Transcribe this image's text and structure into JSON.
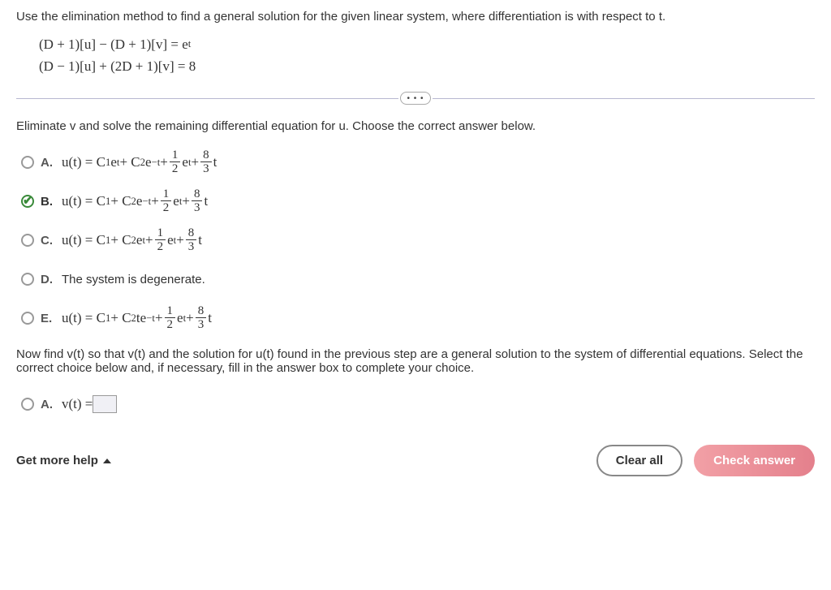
{
  "question": "Use the elimination method to find a general solution for the given linear system, where differentiation is with respect to t.",
  "eq1": "(D + 1)[u] − (D + 1)[v]  =  e",
  "eq1_sup": "t",
  "eq2": "(D − 1)[u] + (2D + 1)[v]  =  8",
  "dots": "• • •",
  "subq1": "Eliminate v and solve the remaining differential equation for u. Choose the correct answer below.",
  "options": {
    "A": {
      "letter": "A.",
      "pre": "u(t) = C",
      "sub1": "1",
      "mid1": " e",
      "sup1": "t",
      "mid2": " + C",
      "sub2": "2",
      "mid3": " e",
      "sup2": "−t",
      "plus1": " + ",
      "f1n": "1",
      "f1d": "2",
      "mid4": " e",
      "sup3": "t",
      "plus2": " + ",
      "f2n": "8",
      "f2d": "3",
      "tail": "t"
    },
    "B": {
      "letter": "B.",
      "pre": "u(t) = C",
      "sub1": "1",
      "mid1": "",
      "sup1": "",
      "mid2": " + C",
      "sub2": "2",
      "mid3": " e",
      "sup2": "−t",
      "plus1": " + ",
      "f1n": "1",
      "f1d": "2",
      "mid4": " e",
      "sup3": "t",
      "plus2": " + ",
      "f2n": "8",
      "f2d": "3",
      "tail": "t"
    },
    "C": {
      "letter": "C.",
      "pre": "u(t) = C",
      "sub1": "1",
      "mid1": "",
      "sup1": "",
      "mid2": " + C",
      "sub2": "2",
      "mid3": " e",
      "sup2": "t",
      "plus1": " + ",
      "f1n": "1",
      "f1d": "2",
      "mid4": " e",
      "sup3": "t",
      "plus2": " + ",
      "f2n": "8",
      "f2d": "3",
      "tail": "t"
    },
    "D": {
      "letter": "D.",
      "text": "The system is degenerate."
    },
    "E": {
      "letter": "E.",
      "pre": "u(t) = C",
      "sub1": "1",
      "mid1": "",
      "sup1": "",
      "mid2": " + C",
      "sub2": "2",
      "mid3": "te",
      "sup2": "−t",
      "plus1": " + ",
      "f1n": "1",
      "f1d": "2",
      "mid4": " e",
      "sup3": "t",
      "plus2": " + ",
      "f2n": "8",
      "f2d": "3",
      "tail": "t"
    }
  },
  "subq2": "Now find v(t) so that v(t) and the solution for u(t) found in the previous step are a general solution to the system of differential equations. Select the correct choice below and, if necessary, fill in the answer box to complete your choice.",
  "opt2A": {
    "letter": "A.",
    "text": "v(t) = "
  },
  "footer": {
    "help": "Get more help",
    "clear": "Clear all",
    "check": "Check answer"
  }
}
